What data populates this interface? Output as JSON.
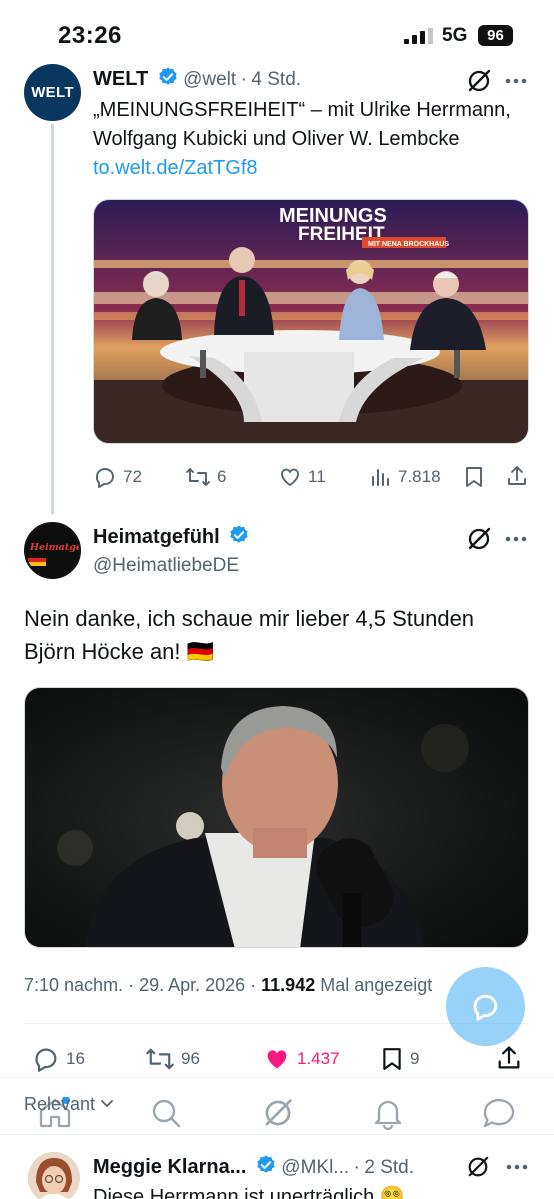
{
  "status_bar": {
    "time": "23:26",
    "network": "5G",
    "battery": "96"
  },
  "tweet1": {
    "avatar_text": "WELT",
    "name": "WELT",
    "handle": "@welt",
    "separator": "·",
    "age": "4 Std.",
    "text": "„MEINUNGSFREIHEIT“ – mit Ulrike Herrmann, Wolfgang Kubicki und Oliver W. Lembcke",
    "link": "to.welt.de/ZatTGf8",
    "media": {
      "title_line1": "MEINUNGS",
      "title_line2": "FREIHEIT",
      "subtitle": "MIT NENA BROCKHAUS"
    },
    "actions": {
      "replies": "72",
      "reposts": "6",
      "likes": "11",
      "views": "7.818"
    }
  },
  "tweet2": {
    "avatar_text": "Heimatgefühl",
    "name": "Heimatgefühl",
    "handle": "@HeimatliebeDE",
    "text": "Nein danke, ich schaue mir lieber 4,5 Stunden Björn Höcke an! 🇩🇪",
    "meta": {
      "time": "7:10 nachm.",
      "separator": " · ",
      "date": "29. Apr. 2026",
      "views_count": "11.942",
      "views_label": "Mal angezeigt"
    },
    "actions": {
      "replies": "16",
      "reposts": "96",
      "likes": "1.437",
      "bookmarks": "9"
    }
  },
  "sort": {
    "label": "Relevant"
  },
  "reply_preview": {
    "name": "Meggie Klarna...",
    "handle": "@MKl...",
    "separator": "·",
    "age": "2 Std.",
    "text": "Diese Herrmann ist unerträglich 😵‍💫"
  },
  "colors": {
    "accent": "#1d9bf0",
    "like": "#f91880",
    "muted": "#536471"
  },
  "icons": [
    "grok-icon",
    "more-icon",
    "reply-icon",
    "repost-icon",
    "like-icon",
    "views-icon",
    "bookmark-icon",
    "share-icon",
    "home-icon",
    "search-icon",
    "notifications-icon",
    "messages-icon",
    "compose-reply-icon"
  ]
}
